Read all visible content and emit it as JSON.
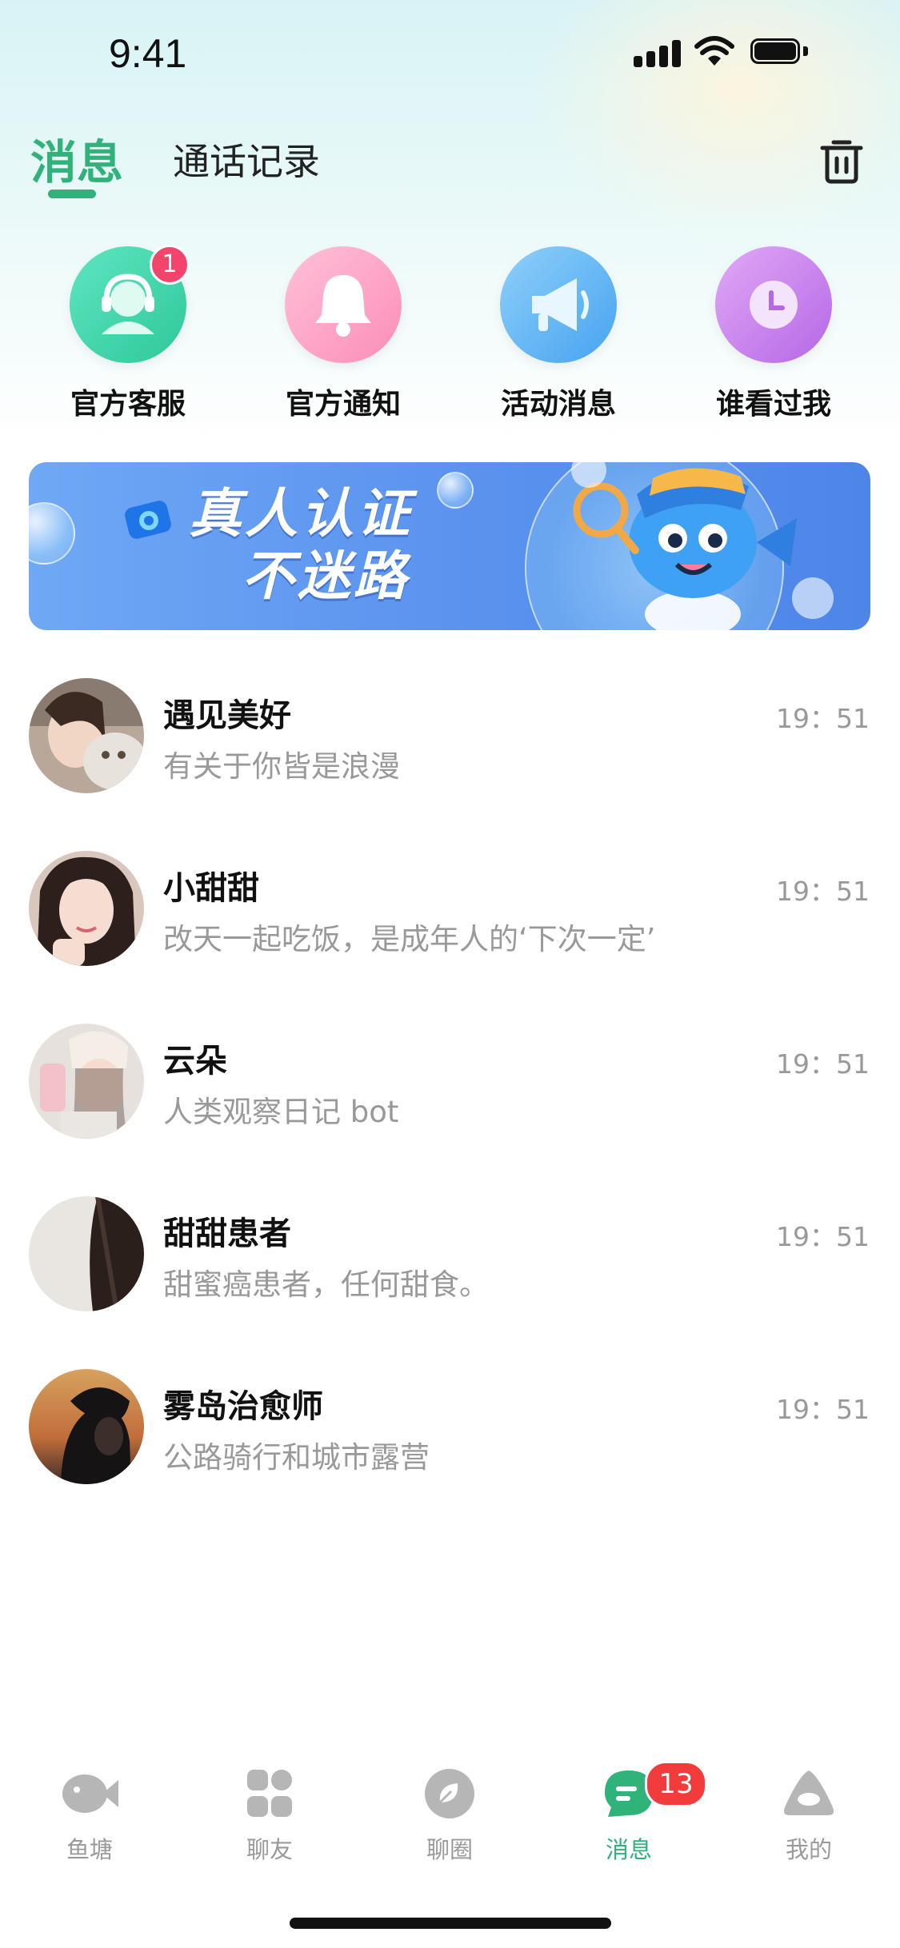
{
  "status_bar": {
    "time": "9:41"
  },
  "header": {
    "tabs": [
      {
        "label": "消息",
        "active": true
      },
      {
        "label": "通话记录",
        "active": false
      }
    ],
    "trash_icon": "trash-icon"
  },
  "quick_entries": [
    {
      "label": "官方客服",
      "icon": "headset-icon",
      "badge": "1",
      "color": "#3fd3ac"
    },
    {
      "label": "官方通知",
      "icon": "bell-icon",
      "color": "#fd9fc3"
    },
    {
      "label": "活动消息",
      "icon": "megaphone-icon",
      "color": "#63b6f5"
    },
    {
      "label": "谁看过我",
      "icon": "clock-icon",
      "color": "#c884ee"
    }
  ],
  "banner": {
    "line1": "真人认证",
    "line2": "不迷路"
  },
  "chats": [
    {
      "name": "遇见美好",
      "preview": "有关于你皆是浪漫",
      "time": "19：51"
    },
    {
      "name": "小甜甜",
      "preview": "改天一起吃饭，是成年人的‘下次一定’",
      "time": "19：51"
    },
    {
      "name": "云朵",
      "preview": "人类观察日记 bot",
      "time": "19：51"
    },
    {
      "name": "甜甜患者",
      "preview": "甜蜜癌患者，任何甜食。",
      "time": "19：51"
    },
    {
      "name": "雾岛治愈师",
      "preview": "公路骑行和城市露营",
      "time": "19：51"
    }
  ],
  "tabbar": {
    "items": [
      {
        "label": "鱼塘",
        "icon": "fish-icon"
      },
      {
        "label": "聊友",
        "icon": "grid-icon"
      },
      {
        "label": "聊圈",
        "icon": "leaf-icon"
      },
      {
        "label": "消息",
        "icon": "chat-bubble-icon",
        "active": true,
        "badge": "13"
      },
      {
        "label": "我的",
        "icon": "profile-icon"
      }
    ]
  },
  "colors": {
    "accent": "#2fb37a",
    "badge": "#f23b3b"
  }
}
